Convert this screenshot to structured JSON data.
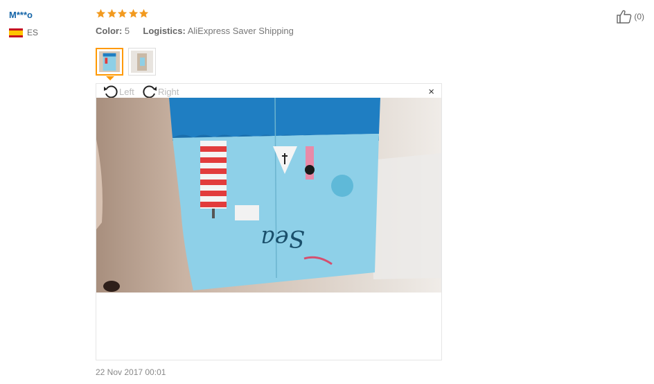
{
  "user": {
    "name": "M***o",
    "country_code": "ES"
  },
  "review": {
    "rating": 5,
    "color_label": "Color:",
    "color_value": "5",
    "logistics_label": "Logistics:",
    "logistics_value": "AliExpress Saver Shipping",
    "date": "22 Nov 2017 00:01"
  },
  "helpful": {
    "count": "(0)"
  },
  "viewer": {
    "rotate_left_label": "Left",
    "rotate_right_label": "Right",
    "close_symbol": "×",
    "image_text": "Sea"
  },
  "colors": {
    "star": "#f29a1f",
    "username": "#1565a8",
    "thumb_active_border": "#ff9900"
  }
}
